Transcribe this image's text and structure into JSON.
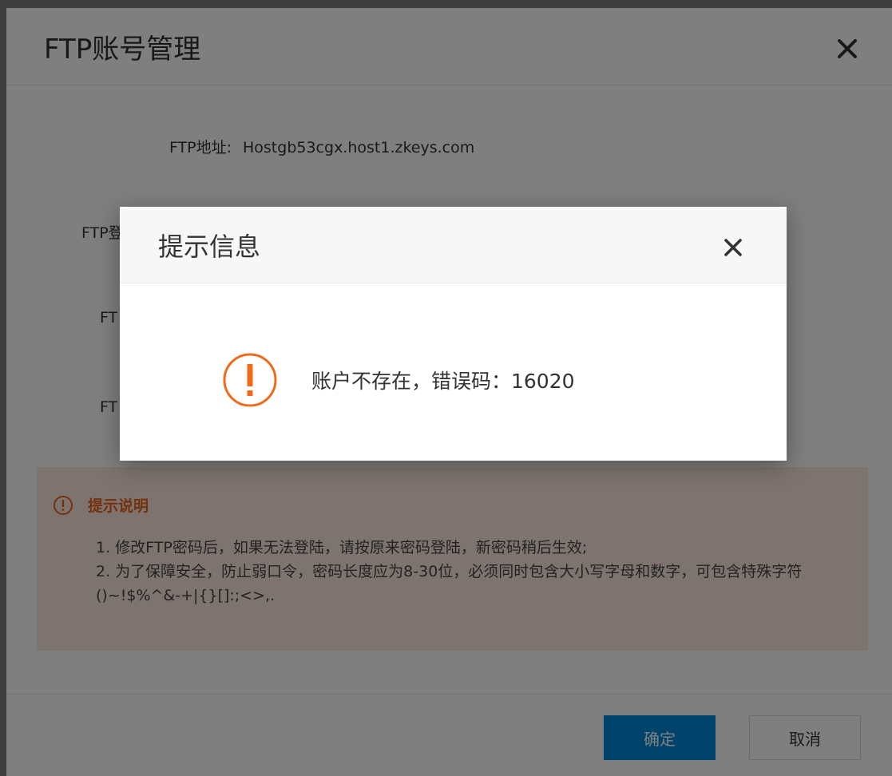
{
  "outer_dialog": {
    "title": "FTP账号管理",
    "ftp_address": {
      "label": "FTP地址:",
      "value": "Hostgb53cgx.host1.zkeys.com"
    },
    "hidden_row_labels": [
      "FTP登",
      "FT",
      "FT"
    ],
    "notice": {
      "title": "提示说明",
      "lines": [
        "1. 修改FTP密码后，如果无法登陆，请按原来密码登陆，新密码稍后生效;",
        "2. 为了保障安全，防止弱口令，密码长度应为8-30位，必须同时包含大小写字母和数字，可包含特殊字符()~!$%^&-+|{}[]:;<>,."
      ]
    },
    "buttons": {
      "ok": "确定",
      "cancel": "取消"
    }
  },
  "alert_modal": {
    "title": "提示信息",
    "message": "账户不存在，错误码：16020"
  },
  "colors": {
    "primary": "#0088d9",
    "warning": "#f06a1b",
    "notice_bg": "#fce9df",
    "overlay": "rgba(0,0,0,0.5)"
  },
  "icons": {
    "outer_close": "close-icon",
    "modal_close": "close-icon",
    "alert": "exclamation-circle-icon",
    "notice": "exclamation-circle-icon"
  }
}
